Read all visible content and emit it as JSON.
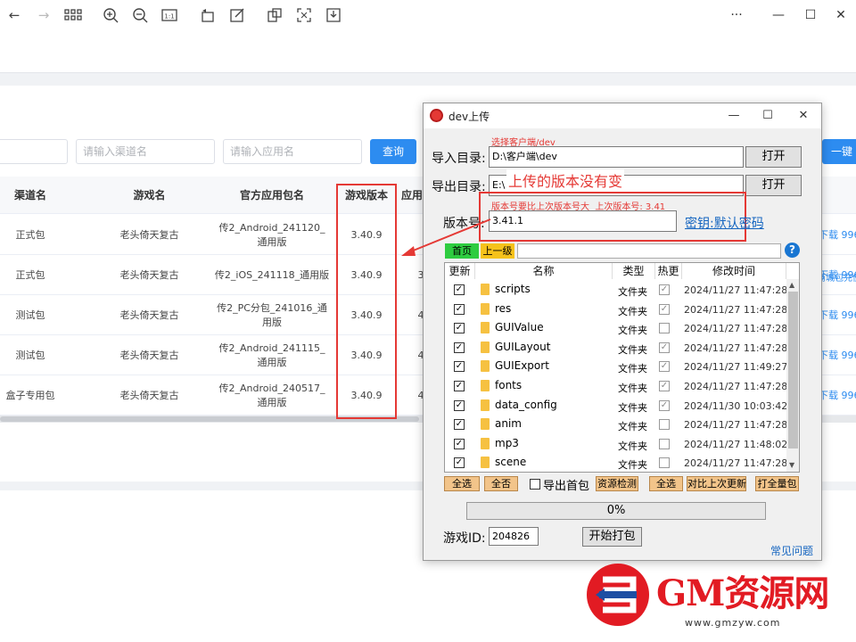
{
  "browser": {
    "icons": [
      "back-icon",
      "forward-icon",
      "grid-icon",
      "zoom-in-icon",
      "zoom-out-icon",
      "actual-size-icon",
      "rotate-icon",
      "edit-icon",
      "crop-icon",
      "fullscreen-icon",
      "save-icon"
    ],
    "window": {
      "more": "···",
      "minimize": "—",
      "maximize": "☐",
      "close": "✕"
    }
  },
  "filters": {
    "channel_placeholder": "请输入渠道名",
    "app_placeholder": "请输入应用名",
    "query_label": "查询",
    "onekey_label": "一键"
  },
  "table": {
    "headers": [
      "渠道名",
      "游戏名",
      "官方应用包名",
      "游戏版本",
      "应用"
    ],
    "rows": [
      {
        "channel": "正式包",
        "game": "老头倚天复古",
        "package": "传2_Android_241120_通用版",
        "version": "3.40.9",
        "app": "",
        "action": "下载",
        "extra": "996"
      },
      {
        "channel": "正式包",
        "game": "老头倚天复古",
        "package": "传2_iOS_241118_通用版",
        "version": "3.40.9",
        "app": "3",
        "action": "下载",
        "extra": "996"
      },
      {
        "channel": "测试包",
        "game": "老头倚天复古",
        "package": "传2_PC分包_241016_通用版",
        "version": "3.40.9",
        "app": "4",
        "action": "下载",
        "extra": "996"
      },
      {
        "channel": "测试包",
        "game": "老头倚天复古",
        "package": "传2_Android_241115_通用版",
        "version": "3.40.9",
        "app": "4",
        "action": "下载",
        "extra": "996"
      },
      {
        "channel": "盒子专用包",
        "game": "老头倚天复古",
        "package": "传2_Android_240517_通用版",
        "version": "3.40.9",
        "app": "4",
        "action": "下载",
        "extra": "996"
      }
    ],
    "row2_extra": "商城包充值"
  },
  "annotations": {
    "note_select": "选择客户端/dev",
    "note_unchanged": "上传的版本没有变",
    "note_version": "版本号要比上次版本号大  上次版本号: 3.41"
  },
  "dialog": {
    "title": "dev上传",
    "import_label": "导入目录:",
    "import_value": "D:\\客户端\\dev",
    "export_label": "导出目录:",
    "export_value": "E:\\",
    "open_label": "打开",
    "version_label": "版本号:",
    "version_value": "3.41.1",
    "key_link": "密钥:默认密码",
    "nav_home": "首页",
    "nav_up": "上一级",
    "list_headers": [
      "更新",
      "名称",
      "类型",
      "热更",
      "修改时间"
    ],
    "files": [
      {
        "name": "scripts",
        "type": "文件夹",
        "hot": true,
        "time": "2024/11/27 11:47:28"
      },
      {
        "name": "res",
        "type": "文件夹",
        "hot": true,
        "time": "2024/11/27 11:47:28"
      },
      {
        "name": "GUIValue",
        "type": "文件夹",
        "hot": false,
        "time": "2024/11/27 11:47:28"
      },
      {
        "name": "GUILayout",
        "type": "文件夹",
        "hot": true,
        "time": "2024/11/27 11:47:28"
      },
      {
        "name": "GUIExport",
        "type": "文件夹",
        "hot": true,
        "time": "2024/11/27 11:49:27"
      },
      {
        "name": "fonts",
        "type": "文件夹",
        "hot": true,
        "time": "2024/11/27 11:47:28"
      },
      {
        "name": "data_config",
        "type": "文件夹",
        "hot": true,
        "time": "2024/11/30 10:03:42"
      },
      {
        "name": "anim",
        "type": "文件夹",
        "hot": false,
        "time": "2024/11/27 11:47:28"
      },
      {
        "name": "mp3",
        "type": "文件夹",
        "hot": false,
        "time": "2024/11/27 11:48:02"
      },
      {
        "name": "scene",
        "type": "文件夹",
        "hot": false,
        "time": "2024/11/27 11:47:28"
      }
    ],
    "btn_select_all": "全选",
    "btn_select_none": "全否",
    "export_first_pack": "导出首包",
    "btn_res_check": "资源检测",
    "btn_select_all_2": "全选",
    "btn_compare": "对比上次更新",
    "btn_full_pack": "打全量包",
    "progress_text": "0%",
    "progress_value": 0,
    "game_id_label": "游戏ID:",
    "game_id_value": "204826",
    "start_pack": "开始打包",
    "faq": "常见问题"
  },
  "watermark": {
    "text": "GM资源网",
    "url": "www.gmzyw.com"
  }
}
